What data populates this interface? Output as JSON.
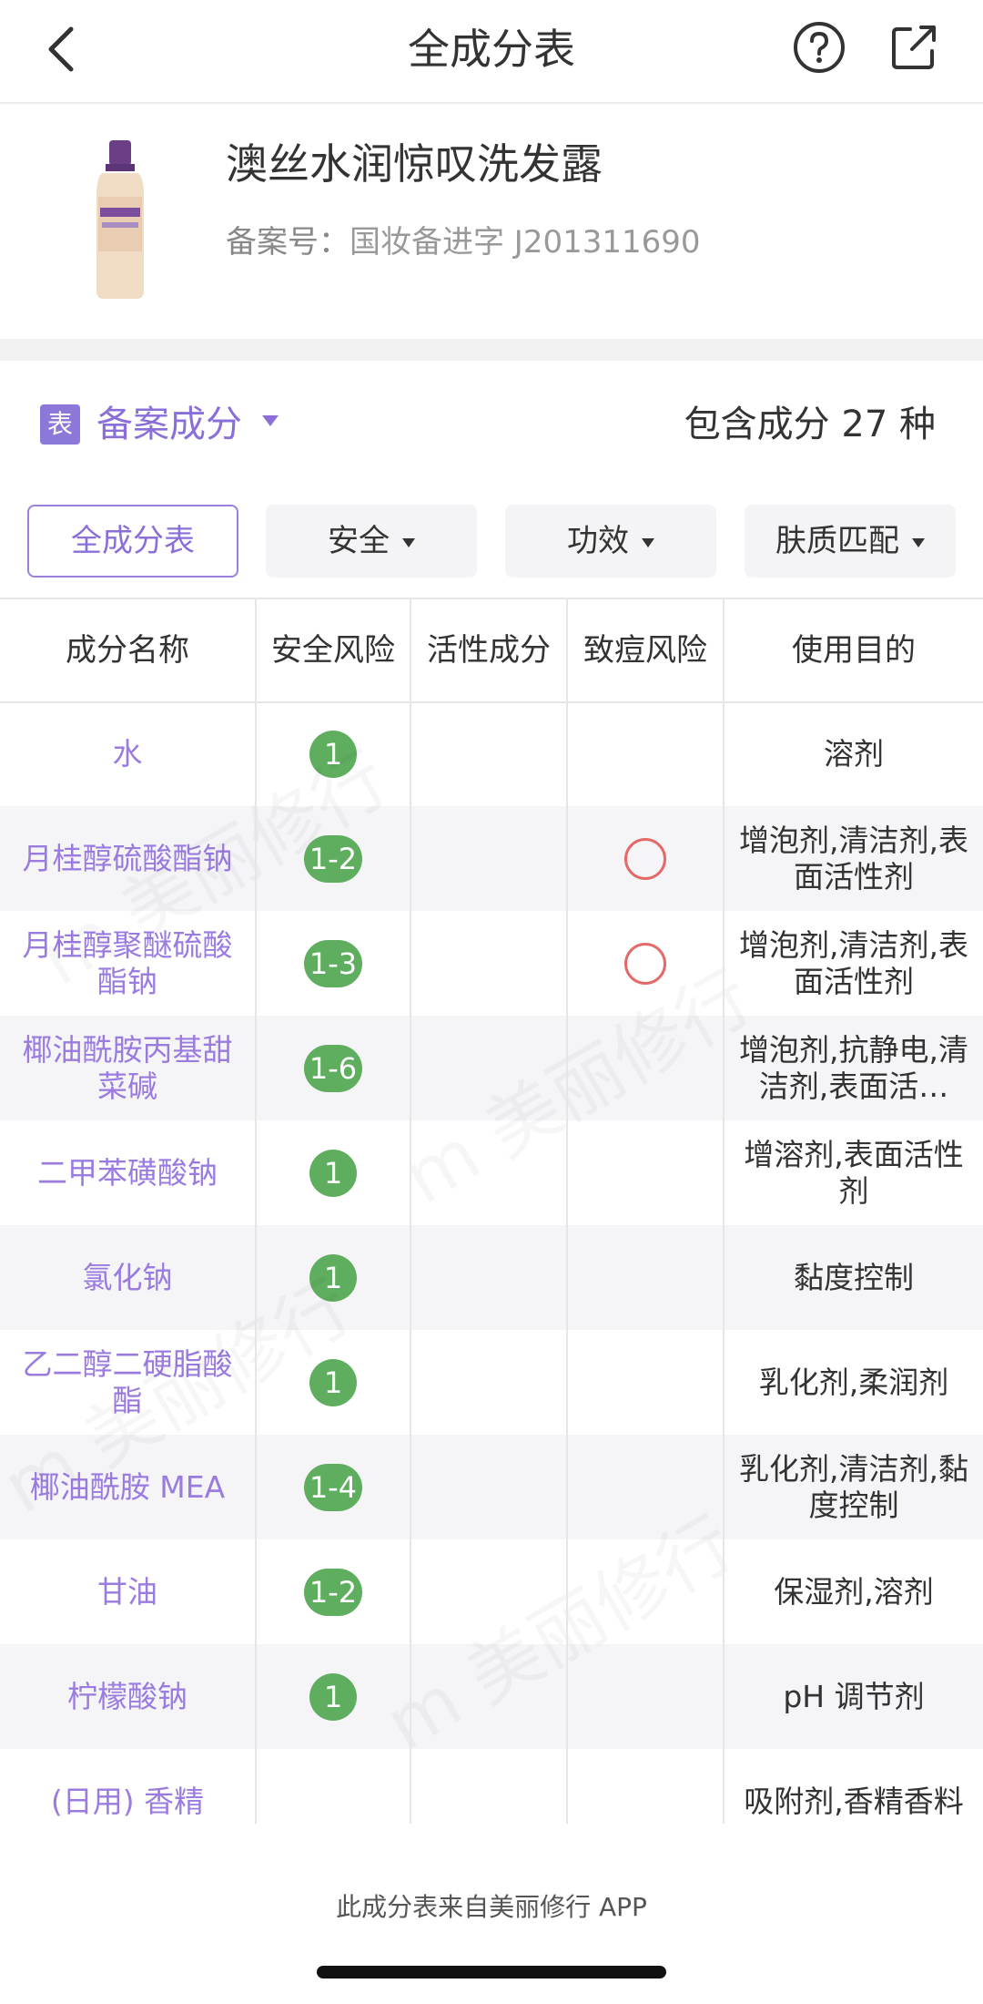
{
  "nav": {
    "title": "全成分表",
    "back_icon": "chevron-left-icon",
    "help_icon": "question-circle-icon",
    "share_icon": "share-icon"
  },
  "product": {
    "name": "澳丝水润惊叹洗发露",
    "reg_label": "备案号：",
    "reg_value": "国妆备进字 J201311690"
  },
  "section": {
    "tag_icon_text": "表",
    "label": "备案成分",
    "count_text": "包含成分 27 种"
  },
  "filters": [
    {
      "label": "全成分表",
      "active": true
    },
    {
      "label": "安全",
      "active": false
    },
    {
      "label": "功效",
      "active": false
    },
    {
      "label": "肤质匹配",
      "active": false
    }
  ],
  "table": {
    "headers": [
      "成分名称",
      "安全风险",
      "活性成分",
      "致痘风险",
      "使用目的"
    ],
    "rows": [
      {
        "name": "水",
        "safety": "1",
        "active": "",
        "acne": false,
        "use": "溶剂"
      },
      {
        "name": "月桂醇硫酸酯钠",
        "safety": "1-2",
        "active": "",
        "acne": true,
        "use": "增泡剂,清洁剂,表面活性剂"
      },
      {
        "name": "月桂醇聚醚硫酸酯钠",
        "safety": "1-3",
        "active": "",
        "acne": true,
        "use": "增泡剂,清洁剂,表面活性剂"
      },
      {
        "name": "椰油酰胺丙基甜菜碱",
        "safety": "1-6",
        "active": "",
        "acne": false,
        "use": "增泡剂,抗静电,清洁剂,表面活…"
      },
      {
        "name": "二甲苯磺酸钠",
        "safety": "1",
        "active": "",
        "acne": false,
        "use": "增溶剂,表面活性剂"
      },
      {
        "name": "氯化钠",
        "safety": "1",
        "active": "",
        "acne": false,
        "use": "黏度控制"
      },
      {
        "name": "乙二醇二硬脂酸酯",
        "safety": "1",
        "active": "",
        "acne": false,
        "use": "乳化剂,柔润剂"
      },
      {
        "name": "椰油酰胺 MEA",
        "safety": "1-4",
        "active": "",
        "acne": false,
        "use": "乳化剂,清洁剂,黏度控制"
      },
      {
        "name": "甘油",
        "safety": "1-2",
        "active": "",
        "acne": false,
        "use": "保湿剂,溶剂"
      },
      {
        "name": "柠檬酸钠",
        "safety": "1",
        "active": "",
        "acne": false,
        "use": "pH 调节剂"
      },
      {
        "name": "(日用) 香精",
        "safety": "",
        "active": "",
        "acne": false,
        "use": "吸附剂,香精香料"
      }
    ]
  },
  "footer": {
    "note": "此成分表来自美丽修行 APP"
  },
  "colors": {
    "accent": "#8b6fd8",
    "safe_badge": "#5fae5f",
    "acne_ring": "#e46a6a"
  }
}
